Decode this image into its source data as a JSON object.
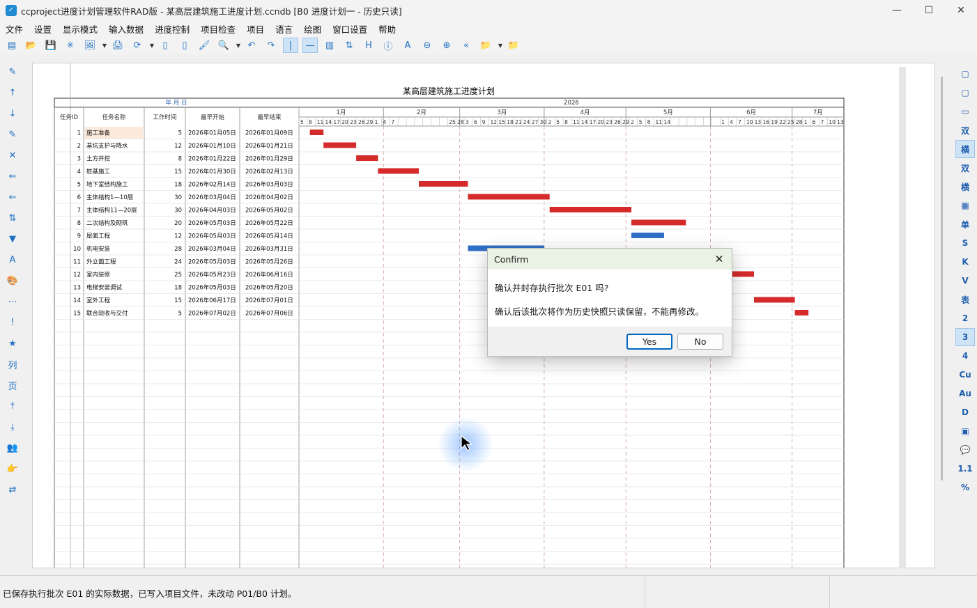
{
  "window": {
    "title": "ccproject进度计划管理软件RAD版 - 某高层建筑施工进度计划.ccndb [B0 进度计划一 - 历史只读]",
    "minimize": "—",
    "maximize": "☐",
    "close": "✕"
  },
  "menu": [
    "文件",
    "设置",
    "显示模式",
    "输入数据",
    "进度控制",
    "项目检查",
    "项目",
    "语言",
    "绘图",
    "窗口设置",
    "帮助"
  ],
  "toolbar_icons": [
    "new-icon",
    "open-icon",
    "save-icon",
    "star-icon",
    "image-icon",
    "print-icon",
    "refresh-icon",
    "copy-icon",
    "paste-icon",
    "format-painter-icon",
    "search-icon",
    "undo-icon",
    "redo-icon",
    "vline-icon",
    "hline-icon",
    "columns-icon",
    "sort-icon",
    "h-icon",
    "info-icon",
    "text-icon",
    "zoom-out-icon",
    "zoom-in-icon",
    "back-icon",
    "folder-icon",
    "folder-red-icon"
  ],
  "toolbar_glyphs": [
    "▤",
    "📂",
    "💾",
    "✳",
    "🖼",
    "🖨",
    "⟳",
    "▯",
    "▯",
    "🖌",
    "🔍",
    "↶",
    "↷",
    "|",
    "—",
    "▥",
    "⇅",
    "H",
    "ⓘ",
    "A",
    "⊖",
    "⊕",
    "«",
    "📁",
    "📁"
  ],
  "leftbar_glyphs": [
    "✎",
    "↑",
    "↓",
    "✎",
    "✕",
    "⇐",
    "⇐",
    "⇅",
    "▼",
    "A",
    "🎨",
    "⋯",
    "!",
    "★",
    "列",
    "页",
    "⤒",
    "⤓",
    "👥",
    "👉",
    "⇄"
  ],
  "rightbar_labels": [
    "▢",
    "▢",
    "▭",
    "双",
    "横",
    "双",
    "横",
    "▦",
    "单",
    "S",
    "K",
    "V",
    "表",
    "2",
    "3",
    "4",
    "Cu",
    "Au",
    "D",
    "▣",
    "💬",
    "1.1",
    "%"
  ],
  "gantt": {
    "title": "某高层建筑施工进度计划",
    "date_header": "年  月  日",
    "year": "2026",
    "columns": [
      "任务ID",
      "任务名称",
      "工作时间",
      "最早开始",
      "最早结束"
    ],
    "months": [
      "1月",
      "2月",
      "3月",
      "4月",
      "5月",
      "6月",
      "7月"
    ],
    "day_ticks": "5|8|11|14|17|20|23|26|29|1|4|7| | | | | | |25|28|3|6|9|12|15|18|21|24|27|30|2|5|8|11|14|17|20|23|26|29|2|5|8|11|14| | | | | | |1|4|7|10|13|16|19|22|25|28|1|6|7|10|13",
    "tasks": [
      {
        "id": "1",
        "name": "施工准备",
        "dur": "5",
        "start": "2026年01月05日",
        "end": "2026年01月09日",
        "d0": 4,
        "d1": 9,
        "color": "#d42a2a"
      },
      {
        "id": "2",
        "name": "基坑支护与降水",
        "dur": "12",
        "start": "2026年01月10日",
        "end": "2026年01月21日",
        "d0": 9,
        "d1": 21,
        "color": "#d42a2a"
      },
      {
        "id": "3",
        "name": "土方开挖",
        "dur": "8",
        "start": "2026年01月22日",
        "end": "2026年01月29日",
        "d0": 21,
        "d1": 29,
        "color": "#d42a2a"
      },
      {
        "id": "4",
        "name": "桩基施工",
        "dur": "15",
        "start": "2026年01月30日",
        "end": "2026年02月13日",
        "d0": 29,
        "d1": 44,
        "color": "#d42a2a"
      },
      {
        "id": "5",
        "name": "地下室结构施工",
        "dur": "18",
        "start": "2026年02月14日",
        "end": "2026年03月03日",
        "d0": 44,
        "d1": 62,
        "color": "#d42a2a"
      },
      {
        "id": "6",
        "name": "主体结构1—10层",
        "dur": "30",
        "start": "2026年03月04日",
        "end": "2026年04月02日",
        "d0": 62,
        "d1": 92,
        "color": "#d42a2a"
      },
      {
        "id": "7",
        "name": "主体结构11—20层",
        "dur": "30",
        "start": "2026年04月03日",
        "end": "2026年05月02日",
        "d0": 92,
        "d1": 122,
        "color": "#d42a2a"
      },
      {
        "id": "8",
        "name": "二次结构及砌筑",
        "dur": "20",
        "start": "2026年05月03日",
        "end": "2026年05月22日",
        "d0": 122,
        "d1": 142,
        "color": "#d42a2a"
      },
      {
        "id": "9",
        "name": "屋面工程",
        "dur": "12",
        "start": "2026年05月03日",
        "end": "2026年05月14日",
        "d0": 122,
        "d1": 134,
        "color": "#2f6fc7"
      },
      {
        "id": "10",
        "name": "机电安装",
        "dur": "28",
        "start": "2026年03月04日",
        "end": "2026年03月31日",
        "d0": 62,
        "d1": 90,
        "color": "#2f6fc7"
      },
      {
        "id": "11",
        "name": "外立面工程",
        "dur": "24",
        "start": "2026年05月03日",
        "end": "2026年05月26日",
        "d0": 122,
        "d1": 146,
        "color": "#d42a2a"
      },
      {
        "id": "12",
        "name": "室内装修",
        "dur": "25",
        "start": "2026年05月23日",
        "end": "2026年06月16日",
        "d0": 142,
        "d1": 167,
        "color": "#d42a2a"
      },
      {
        "id": "13",
        "name": "电梯安装调试",
        "dur": "18",
        "start": "2026年05月03日",
        "end": "2026年05月20日",
        "d0": 122,
        "d1": 140,
        "color": "#d42a2a"
      },
      {
        "id": "14",
        "name": "室外工程",
        "dur": "15",
        "start": "2026年06月17日",
        "end": "2026年07月01日",
        "d0": 167,
        "d1": 182,
        "color": "#d42a2a"
      },
      {
        "id": "15",
        "name": "联合验收与交付",
        "dur": "5",
        "start": "2026年07月02日",
        "end": "2026年07月06日",
        "d0": 182,
        "d1": 187,
        "color": "#d42a2a"
      }
    ]
  },
  "dialog": {
    "title": "Confirm",
    "question": "确认并封存执行批次 E01 吗?",
    "detail": "确认后该批次将作为历史快照只读保留，不能再修改。",
    "yes": "Yes",
    "no": "No",
    "close": "✕"
  },
  "status": {
    "message": "已保存执行批次 E01 的实际数据，已写入项目文件，未改动 P01/B0 计划。"
  }
}
